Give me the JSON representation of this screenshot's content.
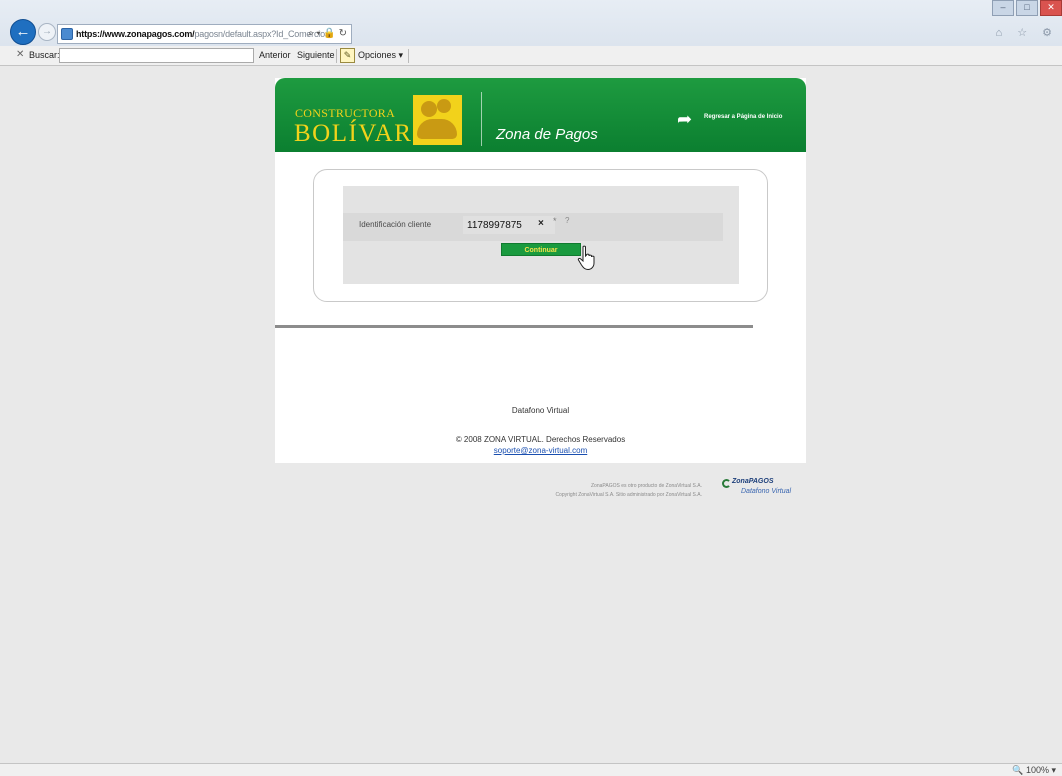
{
  "browser": {
    "url_host": "https://www.zonapagos.com/",
    "url_path": "pagosn/default.aspx?Id_Comercio=",
    "address_tools": "⌕ ▾ 🔒 ↻",
    "window_buttons": [
      "–",
      "□",
      "✕"
    ],
    "right_icons": "⌂ ☆ ⚙"
  },
  "findbar": {
    "close": "✕",
    "label": "Buscar:",
    "value": "",
    "prev": "Anterior",
    "next": "Siguiente",
    "options": "Opciones ▾"
  },
  "header": {
    "brand_top": "CONSTRUCTORA",
    "brand_main": "BOLÍVAR",
    "section": "Zona de Pagos",
    "return_link": "Regresar a Página de Inicio"
  },
  "form": {
    "id_label": "Identificación cliente",
    "id_value": "1178997875",
    "clear": "×",
    "required_mark": "*",
    "help_mark": "?",
    "submit_label": "Continuar"
  },
  "footer": {
    "datafono": "Datafono Virtual",
    "copyright": "© 2008 ZONA VIRTUAL. Derechos Reservados",
    "support_email": "soporte@zona-virtual.com",
    "product_line": "ZonaPAGOS es otro producto de ZonaVirtual S.A.",
    "copyright_line": "Copyright ZonaVirtual S.A. Sitio administrado por ZonaVirtual S.A.",
    "logo_title": "ZonaPAGOS",
    "logo_sub": "Datafono Virtual"
  },
  "status": {
    "zoom": "🔍 100%  ▾"
  },
  "colors": {
    "brand_green": "#1a9a3f",
    "brand_yellow": "#f2d21b"
  }
}
